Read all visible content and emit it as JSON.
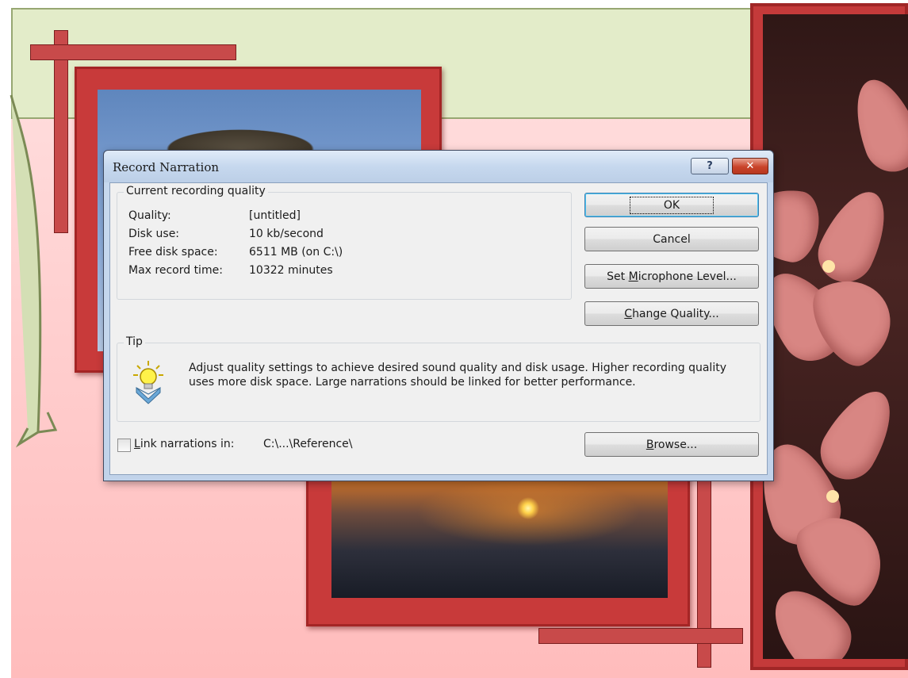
{
  "dialog": {
    "title": "Record Narration",
    "help_button_label": "?",
    "close_button_label": "✕"
  },
  "quality_group": {
    "legend": "Current recording quality",
    "rows": [
      {
        "label": "Quality:",
        "value": "[untitled]"
      },
      {
        "label": "Disk use:",
        "value": "10 kb/second"
      },
      {
        "label": "Free disk space:",
        "value": "6511 MB (on C:\\)"
      },
      {
        "label": "Max record time:",
        "value": "10322 minutes"
      }
    ]
  },
  "buttons": {
    "ok": "OK",
    "cancel": "Cancel",
    "mic_pre": "Set ",
    "mic_key": "M",
    "mic_post": "icrophone Level...",
    "quality_key": "C",
    "quality_post": "hange Quality...",
    "browse_key": "B",
    "browse_post": "rowse..."
  },
  "tip_group": {
    "legend": "Tip",
    "text": "Adjust quality settings to achieve desired sound quality and disk usage. Higher recording quality uses more disk space. Large narrations should be linked for better performance."
  },
  "link": {
    "checked": false,
    "label_key": "L",
    "label_rest": "ink narrations in:",
    "path": "C:\\...\\Reference\\"
  },
  "icons": {
    "tip": "lightbulb-icon",
    "help": "help-icon",
    "close": "close-icon"
  },
  "colors": {
    "slide_background": "#ffd0d0",
    "frame_red": "#c83a3a",
    "callout_green": "#e3ecc9",
    "dialog_chrome": "#c7d9ef",
    "close_button": "#c9432a"
  }
}
